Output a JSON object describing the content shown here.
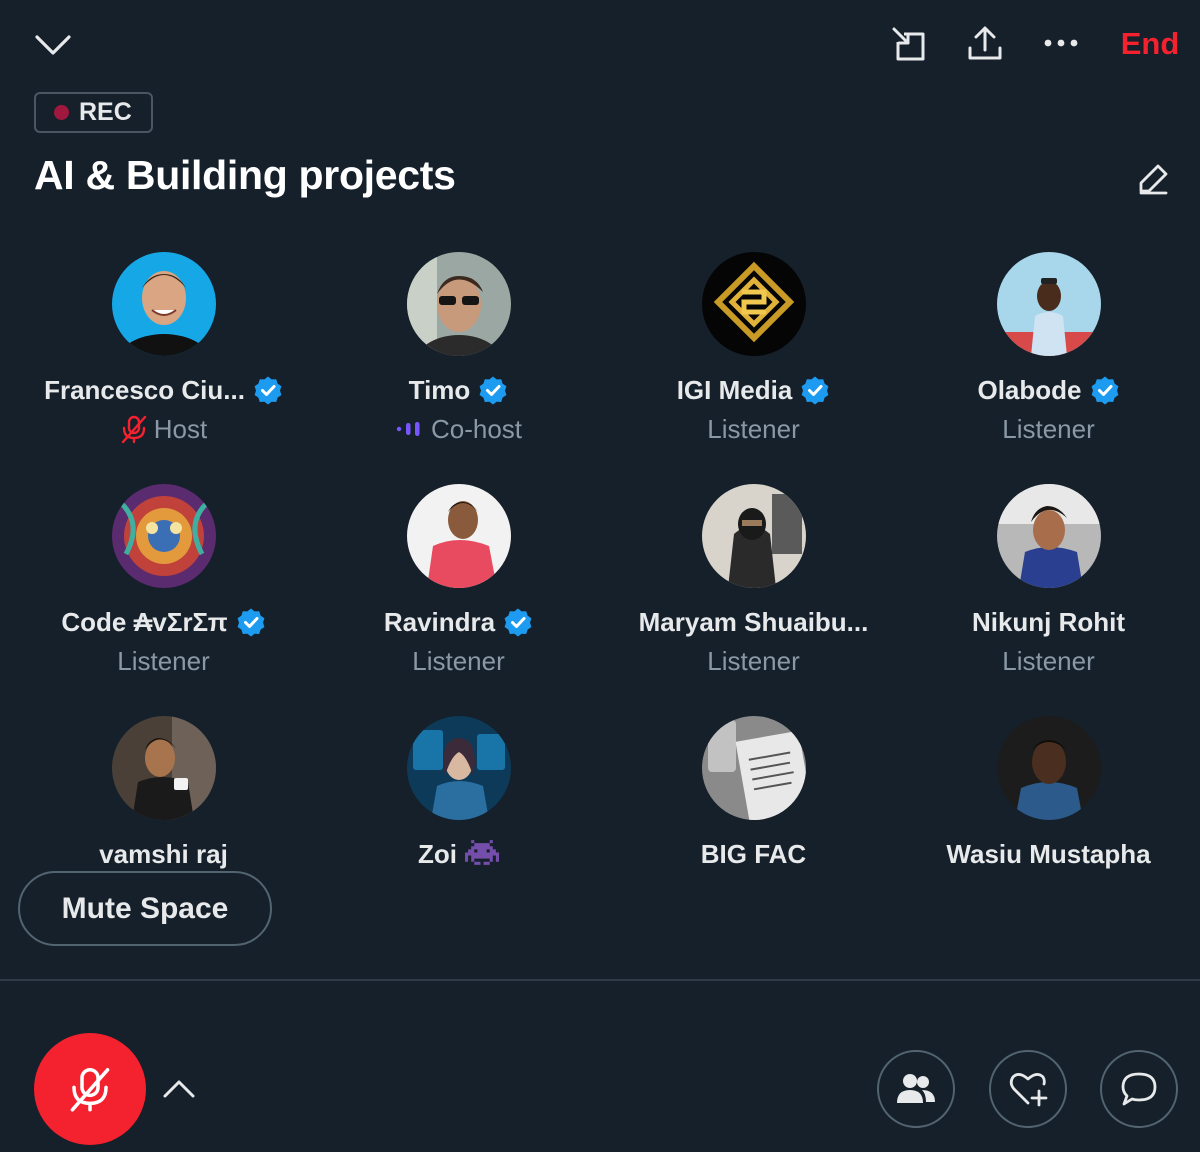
{
  "header": {
    "end_label": "End",
    "rec_label": "REC",
    "title": "AI & Building projects"
  },
  "icons": {
    "collapse": "chevron-down-icon",
    "minimize": "minimize-window-icon",
    "share": "share-icon",
    "more": "more-icon",
    "edit": "edit-icon",
    "verified": "verified-badge-icon",
    "muted": "muted-mic-icon",
    "speaking": "speaking-waveform-icon",
    "space_invader": "alien-monster-emoji-icon",
    "people": "people-icon",
    "react": "heart-plus-icon",
    "chat": "chat-bubble-icon",
    "chevron_up": "chevron-up-icon"
  },
  "colors": {
    "background": "#15202b",
    "end_red": "#f4212e",
    "verified_blue": "#1d9bf0",
    "muted_text": "#8b98a5",
    "speaking_purple": "#7856ff"
  },
  "participants": [
    {
      "name": "Francesco Ciu...",
      "verified": true,
      "role": "Host",
      "role_icon": "muted-mic-icon"
    },
    {
      "name": "Timo",
      "verified": true,
      "role": "Co-host",
      "role_icon": "speaking-waveform-icon"
    },
    {
      "name": "IGI Media",
      "verified": true,
      "role": "Listener"
    },
    {
      "name": "Olabode",
      "verified": true,
      "role": "Listener"
    },
    {
      "name": "Code ₳vΣrΣπ",
      "verified": true,
      "role": "Listener"
    },
    {
      "name": "Ravindra",
      "verified": true,
      "role": "Listener"
    },
    {
      "name": "Maryam Shuaibu...",
      "verified": false,
      "role": "Listener"
    },
    {
      "name": "Nikunj Rohit",
      "verified": false,
      "role": "Listener"
    },
    {
      "name": "vamshi raj",
      "verified": false,
      "role": ""
    },
    {
      "name": "Zoi",
      "verified": false,
      "role": "",
      "emoji": "👾"
    },
    {
      "name": "BIG FAC",
      "verified": false,
      "role": ""
    },
    {
      "name": "Wasiu Mustapha",
      "verified": false,
      "role": ""
    }
  ],
  "controls": {
    "mute_space_label": "Mute Space"
  }
}
